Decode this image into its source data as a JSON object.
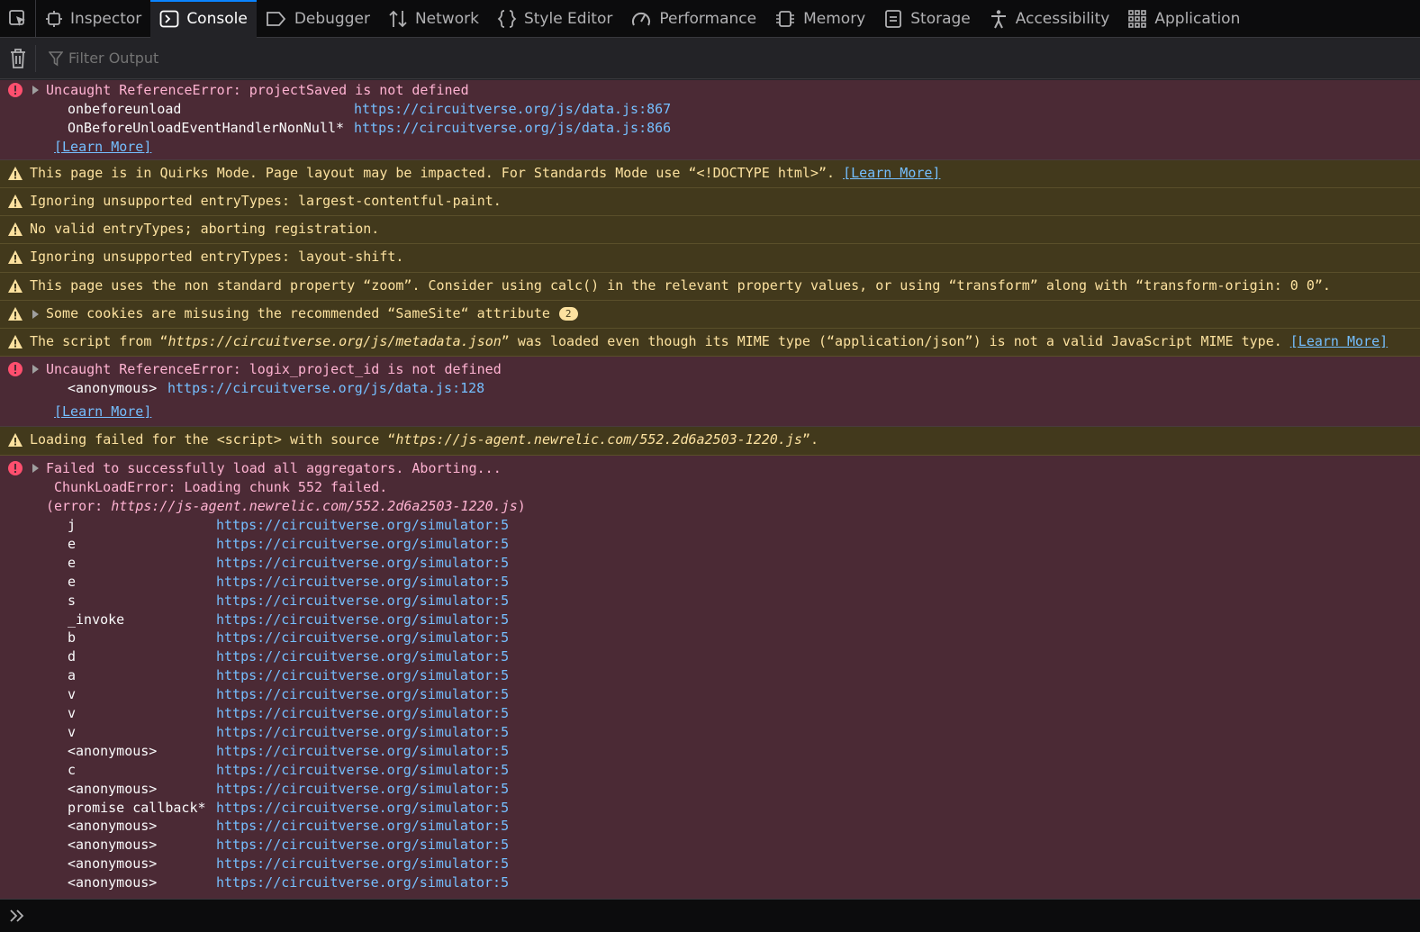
{
  "toolbar": {
    "tabs": [
      {
        "label": "Inspector",
        "icon": "inspector-icon"
      },
      {
        "label": "Console",
        "icon": "console-icon"
      },
      {
        "label": "Debugger",
        "icon": "debugger-icon"
      },
      {
        "label": "Network",
        "icon": "network-icon"
      },
      {
        "label": "Style Editor",
        "icon": "style-editor-icon"
      },
      {
        "label": "Performance",
        "icon": "performance-icon"
      },
      {
        "label": "Memory",
        "icon": "memory-icon"
      },
      {
        "label": "Storage",
        "icon": "storage-icon"
      },
      {
        "label": "Accessibility",
        "icon": "accessibility-icon"
      },
      {
        "label": "Application",
        "icon": "application-icon"
      }
    ]
  },
  "filter": {
    "placeholder": "Filter Output"
  },
  "messages": {
    "m1": {
      "text": "Uncaught ReferenceError: projectSaved is not defined",
      "frames": [
        {
          "fn": "onbeforeunload",
          "loc": "https://circuitverse.org/js/data.js:867"
        },
        {
          "fn": "OnBeforeUnloadEventHandlerNonNull*",
          "loc": "https://circuitverse.org/js/data.js:866"
        }
      ],
      "learn": "[Learn More]"
    },
    "m2": {
      "text": "This page is in Quirks Mode. Page layout may be impacted. For Standards Mode use “<!DOCTYPE html>”. ",
      "learn": "[Learn More]"
    },
    "m3": {
      "text": "Ignoring unsupported entryTypes: largest-contentful-paint."
    },
    "m4": {
      "text": "No valid entryTypes; aborting registration."
    },
    "m5": {
      "text": "Ignoring unsupported entryTypes: layout-shift."
    },
    "m6": {
      "text": "This page uses the non standard property “zoom”. Consider using calc() in the relevant property values, or using “transform” along with “transform-origin: 0 0”."
    },
    "m7": {
      "text": "Some cookies are misusing the recommended “SameSite“ attribute",
      "count": "2"
    },
    "m8": {
      "pre": "The script from “",
      "url": "https://circuitverse.org/js/metadata.json",
      "post": "” was loaded even though its MIME type (“application/json”) is not a valid JavaScript MIME type. ",
      "learn": "[Learn More]"
    },
    "m9": {
      "text": "Uncaught ReferenceError: logix_project_id is not defined",
      "frames": [
        {
          "fn": "<anonymous>",
          "loc": "https://circuitverse.org/js/data.js:128"
        }
      ],
      "learn": "[Learn More]"
    },
    "m10": {
      "pre": "Loading failed for the <script> with source “",
      "url": "https://js-agent.newrelic.com/552.2d6a2503-1220.js",
      "post": "”."
    },
    "m11": {
      "text": "Failed to successfully load all aggregators. Aborting...",
      "sub1": "ChunkLoadError: Loading chunk 552 failed.",
      "sub2_pre": "(error: ",
      "sub2_url": "https://js-agent.newrelic.com/552.2d6a2503-1220.js",
      "sub2_post": ")",
      "frames": [
        {
          "fn": "j",
          "loc": "https://circuitverse.org/simulator:5"
        },
        {
          "fn": "e",
          "loc": "https://circuitverse.org/simulator:5"
        },
        {
          "fn": "e",
          "loc": "https://circuitverse.org/simulator:5"
        },
        {
          "fn": "e",
          "loc": "https://circuitverse.org/simulator:5"
        },
        {
          "fn": "s",
          "loc": "https://circuitverse.org/simulator:5"
        },
        {
          "fn": "_invoke",
          "loc": "https://circuitverse.org/simulator:5"
        },
        {
          "fn": "b",
          "loc": "https://circuitverse.org/simulator:5"
        },
        {
          "fn": "d",
          "loc": "https://circuitverse.org/simulator:5"
        },
        {
          "fn": "a",
          "loc": "https://circuitverse.org/simulator:5"
        },
        {
          "fn": "v",
          "loc": "https://circuitverse.org/simulator:5"
        },
        {
          "fn": "v",
          "loc": "https://circuitverse.org/simulator:5"
        },
        {
          "fn": "v",
          "loc": "https://circuitverse.org/simulator:5"
        },
        {
          "fn": "<anonymous>",
          "loc": "https://circuitverse.org/simulator:5"
        },
        {
          "fn": "c",
          "loc": "https://circuitverse.org/simulator:5"
        },
        {
          "fn": "<anonymous>",
          "loc": "https://circuitverse.org/simulator:5"
        },
        {
          "fn": "promise callback*",
          "loc": "https://circuitverse.org/simulator:5"
        },
        {
          "fn": "<anonymous>",
          "loc": "https://circuitverse.org/simulator:5"
        },
        {
          "fn": "<anonymous>",
          "loc": "https://circuitverse.org/simulator:5"
        },
        {
          "fn": "<anonymous>",
          "loc": "https://circuitverse.org/simulator:5"
        },
        {
          "fn": "<anonymous>",
          "loc": "https://circuitverse.org/simulator:5"
        }
      ]
    }
  },
  "colors": {
    "accent": "#0a84ff",
    "error_bg": "#4b2a35",
    "warn_bg": "#42391c",
    "link": "#75bfff"
  }
}
